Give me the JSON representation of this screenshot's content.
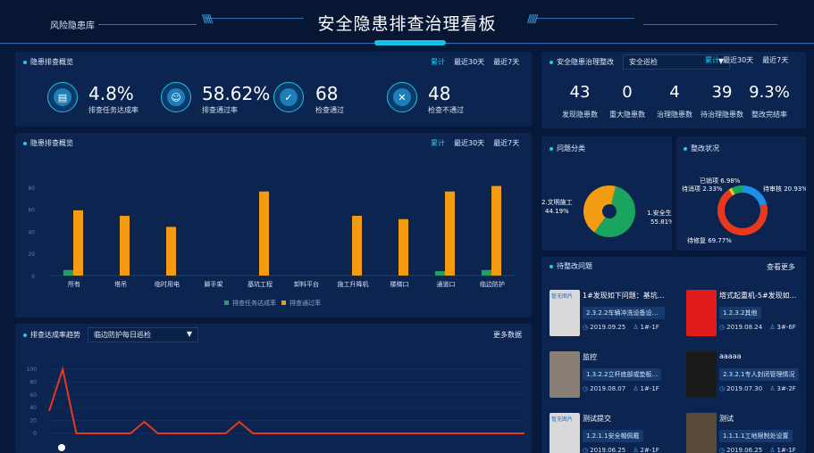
{
  "header": {
    "title": "安全隐患排查治理看板",
    "subtitle": "风险隐患库"
  },
  "overview": {
    "title": "隐患排查概览",
    "tabs": [
      "累计",
      "最近30天",
      "最近7天"
    ],
    "active_tab": "累计",
    "stats": [
      {
        "value": "4.8%",
        "label": "排查任务达成率",
        "icon": "task-report-icon"
      },
      {
        "value": "58.62%",
        "label": "排查通过率",
        "icon": "inspector-icon"
      },
      {
        "value": "68",
        "label": "检查通过",
        "icon": "shield-check-icon"
      },
      {
        "value": "48",
        "label": "检查不通过",
        "icon": "document-x-icon"
      }
    ]
  },
  "bar_panel": {
    "title": "隐患排查概览",
    "tabs": [
      "累计",
      "最近30天",
      "最近7天"
    ],
    "active_tab": "累计"
  },
  "chart_data": [
    {
      "type": "bar",
      "categories": [
        "所有",
        "塔吊",
        "临时用电",
        "脚手架",
        "基坑工程",
        "卸料平台",
        "施工升降机",
        "楼梯口",
        "通道口",
        "临边防护"
      ],
      "series": [
        {
          "name": "排查任务达成率",
          "values": [
            5,
            0,
            0,
            0,
            0,
            0,
            0,
            0,
            4,
            5
          ],
          "color": "#19a45f"
        },
        {
          "name": "排查通过率",
          "values": [
            59,
            54,
            44,
            0,
            76,
            0,
            54,
            51,
            76,
            81
          ],
          "color": "#f39c12"
        }
      ],
      "yticks": [
        "0",
        "20",
        "40",
        "60",
        "80"
      ],
      "ylim": [
        0,
        100
      ],
      "legend": "bottom-center",
      "grid": false
    },
    {
      "type": "line",
      "series": [
        {
          "name": "",
          "values": [
            35,
            100,
            0,
            0,
            0,
            0,
            0,
            18,
            0,
            0,
            0,
            0,
            0,
            0,
            18,
            0,
            0,
            0,
            0,
            0,
            0,
            0,
            0,
            0,
            0,
            0,
            0,
            0,
            0,
            0,
            0,
            0,
            0,
            0,
            0,
            0
          ],
          "color": "#e8391c"
        }
      ],
      "yticks": [
        "0",
        "20",
        "40",
        "60",
        "80",
        "100"
      ],
      "ylim": [
        0,
        100
      ],
      "grid": true
    },
    {
      "type": "pie",
      "title": "问题分类",
      "slices": [
        {
          "label": "1.安全生产",
          "value": 55.81,
          "display": "55.81%",
          "color": "#19a45f"
        },
        {
          "label": "2.文明施工",
          "value": 44.19,
          "display": "44.19%",
          "color": "#f39c12"
        }
      ]
    },
    {
      "type": "pie",
      "title": "整改状况",
      "slices": [
        {
          "label": "待审核",
          "value": 20.93,
          "display": "20.93%",
          "color": "#1e8ee8"
        },
        {
          "label": "待修复",
          "value": 69.77,
          "display": "69.77%",
          "color": "#e8391c"
        },
        {
          "label": "待消项",
          "value": 2.33,
          "display": "2.33%",
          "color": "#f3c212"
        },
        {
          "label": "已销项",
          "value": 6.98,
          "display": "6.98%",
          "color": "#19a45f"
        }
      ]
    }
  ],
  "trend": {
    "title": "排查达成率趋势",
    "select_value": "临边防护每日巡检",
    "more": "更多数据"
  },
  "rectify": {
    "title": "安全隐患治理整改",
    "select_value": "安全巡检",
    "tabs": [
      "累计",
      "最近30天",
      "最近7天"
    ],
    "active_tab": "累计",
    "stats": [
      {
        "value": "43",
        "label": "发现隐患数"
      },
      {
        "value": "0",
        "label": "重大隐患数"
      },
      {
        "value": "4",
        "label": "治理隐患数"
      },
      {
        "value": "39",
        "label": "待治理隐患数"
      },
      {
        "value": "9.3%",
        "label": "整改完结率"
      }
    ]
  },
  "issue_category": {
    "title": "问题分类"
  },
  "rectify_status": {
    "title": "整改状况"
  },
  "pending": {
    "title": "待整改问题",
    "more": "查看更多",
    "items": [
      {
        "title": "1#发现如下问题：基坑...",
        "tag": "2.3.2.2车辆冲洗设备设置...",
        "date": "2019.09.25",
        "location": "1#-1F",
        "thumb": "broken-image-icon",
        "thumb_color": "#d9d9d9",
        "thumb_alt": "暂无图片"
      },
      {
        "title": "塔式起重机-5#发现如...",
        "tag": "1.2.3.2其他",
        "date": "2019.08.24",
        "location": "3#-6F",
        "thumb": "red-photo",
        "thumb_color": "#e01b1b",
        "thumb_alt": ""
      },
      {
        "title": "监控",
        "tag": "1.3.2.2立杆底部或垫板...",
        "date": "2019.08.07",
        "location": "1#-1F",
        "thumb": "office-photo",
        "thumb_color": "#8a7f76",
        "thumb_alt": ""
      },
      {
        "title": "aaaaa",
        "tag": "2.3.2.1专人封闭管理情况",
        "date": "2019.07.30",
        "location": "3#-2F",
        "thumb": "dark-photo",
        "thumb_color": "#1a1a1a",
        "thumb_alt": ""
      },
      {
        "title": "测试提交",
        "tag": "1.2.1.1安全帽佩戴",
        "date": "2019.06.25",
        "location": "2#-1F",
        "thumb": "broken-image-icon",
        "thumb_color": "#d9d9d9",
        "thumb_alt": "暂无图片"
      },
      {
        "title": "测试",
        "tag": "1.1.1.1工地限制处设置",
        "date": "2019.06.25",
        "location": "1#-1F",
        "thumb": "site-photo",
        "thumb_color": "#5a4a3a",
        "thumb_alt": ""
      }
    ]
  },
  "colors": {
    "accent": "#23c7e9",
    "panel": "#0b2550",
    "background": "#07193a"
  }
}
